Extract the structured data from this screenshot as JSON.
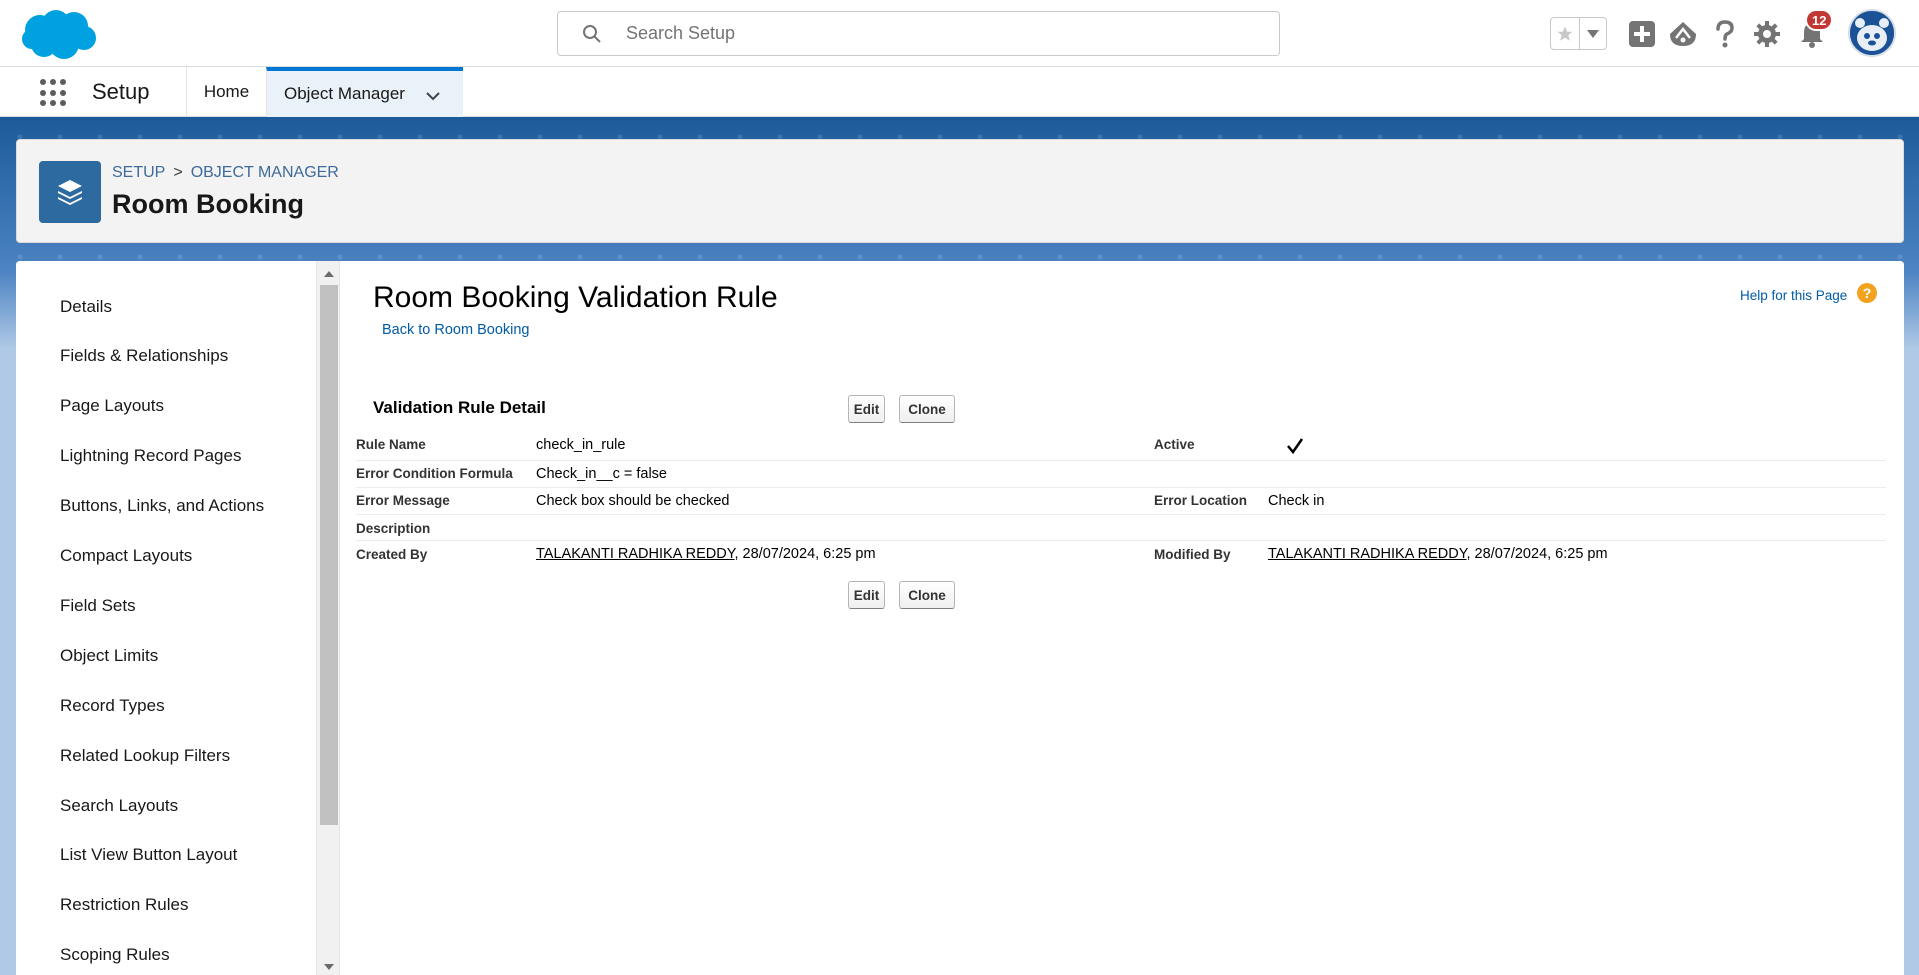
{
  "header": {
    "search_placeholder": "Search Setup",
    "notification_count": "12"
  },
  "nav": {
    "app_name": "Setup",
    "tabs": [
      {
        "label": "Home"
      },
      {
        "label": "Object Manager"
      }
    ]
  },
  "page_header": {
    "breadcrumb": [
      "SETUP",
      "OBJECT MANAGER"
    ],
    "breadcrumb_sep": ">",
    "title": "Room Booking"
  },
  "sidebar": {
    "items": [
      {
        "label": "Details"
      },
      {
        "label": "Fields & Relationships"
      },
      {
        "label": "Page Layouts"
      },
      {
        "label": "Lightning Record Pages"
      },
      {
        "label": "Buttons, Links, and Actions"
      },
      {
        "label": "Compact Layouts"
      },
      {
        "label": "Field Sets"
      },
      {
        "label": "Object Limits"
      },
      {
        "label": "Record Types"
      },
      {
        "label": "Related Lookup Filters"
      },
      {
        "label": "Search Layouts"
      },
      {
        "label": "List View Button Layout"
      },
      {
        "label": "Restriction Rules"
      },
      {
        "label": "Scoping Rules"
      }
    ]
  },
  "content": {
    "title": "Room Booking Validation Rule",
    "back_link": "Back to Room Booking",
    "help_link": "Help for this Page",
    "help_icon": "?",
    "section_title": "Validation Rule Detail",
    "edit_label": "Edit",
    "clone_label": "Clone",
    "detail": {
      "rule_name_label": "Rule Name",
      "rule_name": "check_in_rule",
      "active_label": "Active",
      "error_formula_label": "Error Condition Formula",
      "error_formula": "Check_in__c = false",
      "error_message_label": "Error Message",
      "error_message": "Check box should be checked",
      "error_location_label": "Error Location",
      "error_location": "Check in",
      "description_label": "Description",
      "created_by_label": "Created By",
      "created_by_user": "TALAKANTI RADHIKA REDDY",
      "created_by_date": ", 28/07/2024, 6:25 pm",
      "modified_by_label": "Modified By",
      "modified_by_user": "TALAKANTI RADHIKA REDDY",
      "modified_by_date": ", 28/07/2024, 6:25 pm"
    }
  },
  "colors": {
    "brand_blue": "#0176d3",
    "object_icon": "#2c6aa0",
    "link": "#015ba7",
    "badge": "#c23934"
  },
  "icons": [
    "salesforce-cloud-logo",
    "search-icon",
    "favorite-star-icon",
    "chevron-down-icon",
    "add-icon",
    "trailhead-icon",
    "help-icon",
    "gear-icon",
    "bell-icon",
    "avatar",
    "app-launcher-icon",
    "layers-icon",
    "check-icon"
  ]
}
